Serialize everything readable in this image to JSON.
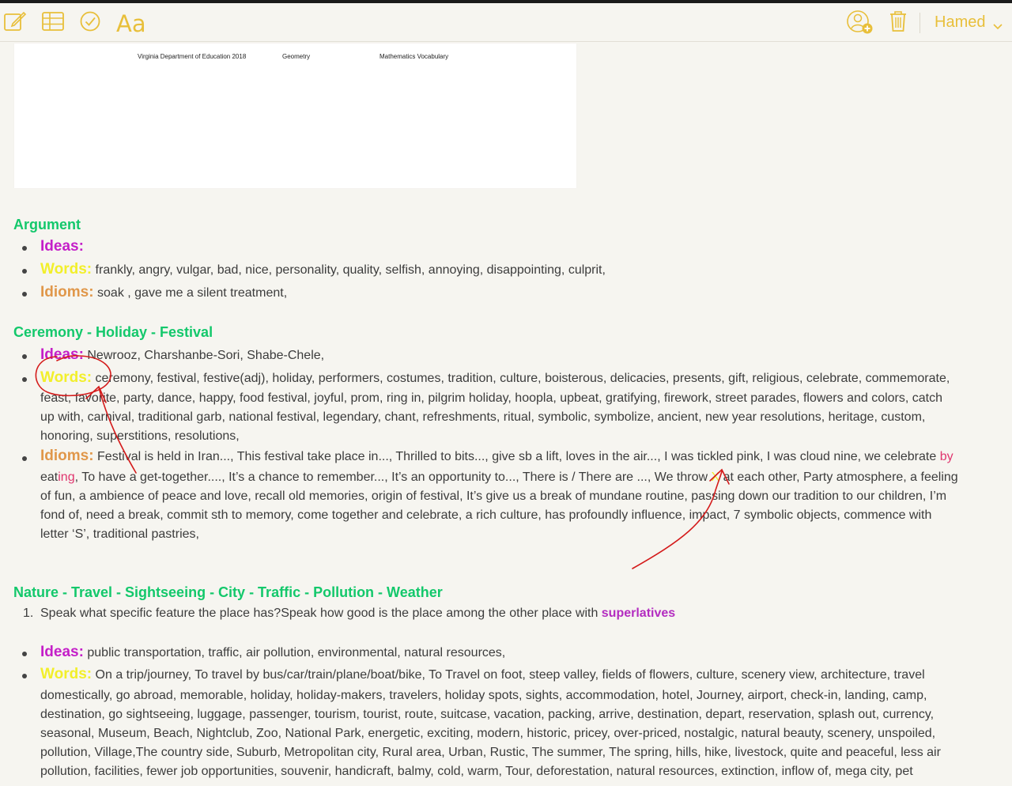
{
  "toolbar": {
    "icons": [
      "compose-icon",
      "table-icon",
      "checklist-icon",
      "format-icon",
      "add-person-icon",
      "trash-icon"
    ],
    "format_label": "Aa",
    "user_name": "Hamed",
    "accent": "#e8bf3a"
  },
  "pdf": {
    "header_1": "Virginia Department of Education 2018",
    "header_2": "Geometry",
    "header_3": "Mathematics Vocabulary"
  },
  "colors": {
    "heading": "#13c86b",
    "ideas": "#c41fc8",
    "words": "#f2ef2a",
    "idioms": "#e0974a",
    "ink": "#d41b1b"
  },
  "labels": {
    "ideas": "Ideas:",
    "words": "Words:",
    "idioms": "Idioms:"
  },
  "argument": {
    "title": "Argument",
    "ideas": "",
    "words": "frankly, angry, vulgar, bad, nice, personality, quality, selfish, annoying, disappointing, culprit,",
    "idioms": "soak , gave me a silent treatment,"
  },
  "ceremony": {
    "title": "Ceremony - Holiday - Festival",
    "ideas": "Newrooz, Charshanbe-Sori, Shabe-Chele,",
    "words_lines": [
      "ceremony, festival, festive(adj), holiday, performers, costumes, tradition, culture, boisterous, delicacies, presents, gift, religious, celebrate, commemorate,",
      "feast, favorite, party, dance, happy, food festival, joyful, prom, ring in, pilgrim holiday, hoopla, upbeat, gratifying, firework, street parades, flowers and colors, catch",
      "up with, carnival, traditional garb, national festival, legendary, chant, refreshments, ritual, symbolic, symbolize, ancient, new year resolutions, heritage, custom,",
      "honoring, superstitions, resolutions,"
    ],
    "idioms_l1_a": "Festival is held in Iran..., This festival take place in..., Thrilled to bits..., give sb a lift, loves in the air..., I was tickled pink, I was cloud nine, we celebrate ",
    "idioms_l1_b": "by",
    "idioms_l2_a": "eat",
    "idioms_l2_b": "ing",
    "idioms_l2_c": ", To have a get-together...., It’s a chance to remember..., It’s an opportunity to..., There is / There are ..., We throw ",
    "idioms_l2_d": "X",
    "idioms_l2_e": " at each other, Party atmosphere, a feeling",
    "idioms_l3": "of fun, a ambience of peace and love, recall old memories, origin of festival, It’s give us a break of mundane routine, passing down our tradition to our children, I’m",
    "idioms_l4": "fond of, need a break, commit sth to memory, come together and celebrate,  a rich culture, has profoundly influence, impact, 7 symbolic objects, commence with",
    "idioms_l5": "letter ‘S’, traditional pastries,"
  },
  "nature": {
    "title": "Nature - Travel - Sightseeing - City - Traffic - Pollution  - Weather",
    "item_number": "1.",
    "item_text": "Speak what specific feature the place has?Speak how good is the place among the other place with ",
    "item_highlight": "superlatives",
    "ideas": "public transportation, traffic, air pollution, environmental, natural resources,",
    "words_l1": "On a trip/journey, To travel by bus/car/train/plane/boat/bike, To Travel on foot, steep valley, fields of flowers, culture, scenery view, architecture, travel",
    "words_lines": [
      "domestically, go abroad, memorable, holiday, holiday-makers, travelers, holiday spots, sights, accommodation, hotel, Journey, airport, check-in, landing, camp,",
      "destination, go sightseeing, luggage, passenger, tourism, tourist, route, suitcase, vacation, packing, arrive, destination, depart, reservation, splash out, currency,",
      "seasonal, Museum, Beach, Nightclub, Zoo, National Park, energetic, exciting, modern, historic, pricey, over-priced, nostalgic, natural beauty, scenery, unspoiled,",
      "pollution, Village,The country side, Suburb, Metropolitan city, Rural area, Urban, Rustic, The summer, The spring, hills, hike, livestock, quite and peaceful, less air",
      "pollution, facilities, fewer job opportunities, souvenir, handicraft, balmy, cold, warm, Tour, deforestation, natural resources, extinction, inflow of, mega city, pet"
    ]
  }
}
